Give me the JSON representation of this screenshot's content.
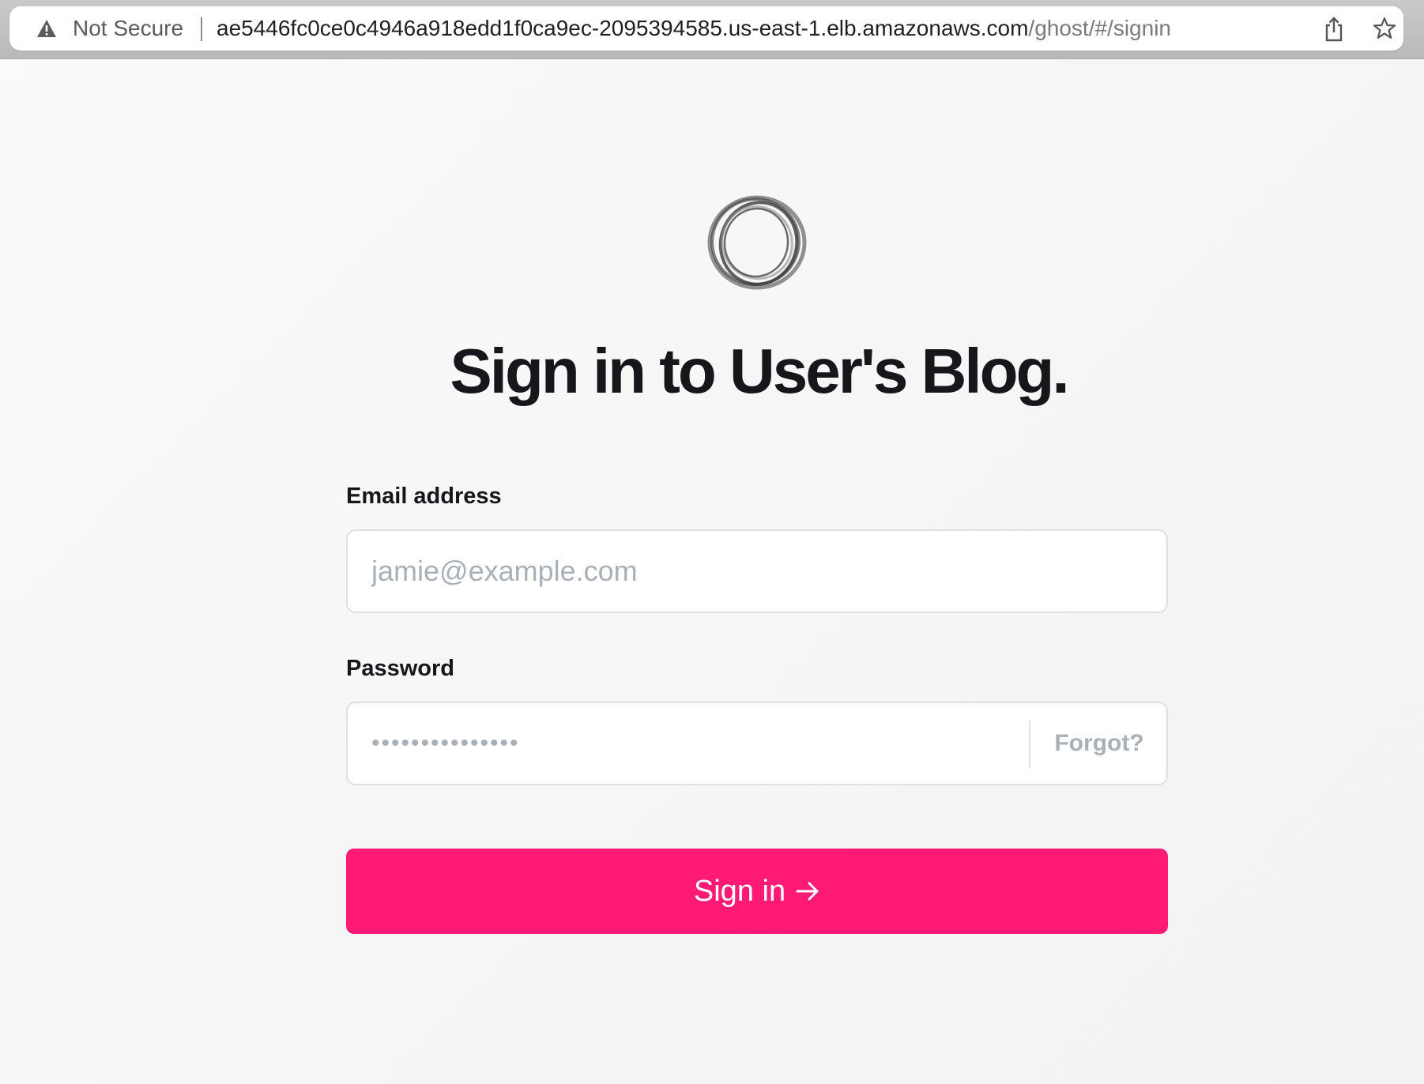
{
  "browser": {
    "security_label": "Not Secure",
    "url_host": "ae5446fc0ce0c4946a918edd1f0ca9ec-2095394585.us-east-1.elb.amazonaws.com",
    "url_path": "/ghost/#/signin",
    "icons": [
      "warning-icon",
      "share-icon",
      "star-icon"
    ]
  },
  "page": {
    "logo_icon": "ghost-logo-ring-icon",
    "heading": "Sign in to User's Blog.",
    "form": {
      "email_label": "Email address",
      "email_placeholder": "jamie@example.com",
      "email_value": "",
      "password_label": "Password",
      "password_value": "•••••••••••••••",
      "forgot_label": "Forgot?",
      "submit_label": "Sign in",
      "submit_icon": "arrow-right-icon"
    },
    "colors": {
      "accent": "#ff1a75",
      "heading": "#15171a",
      "placeholder": "#a9b0b8",
      "border": "#dde1e5"
    }
  }
}
